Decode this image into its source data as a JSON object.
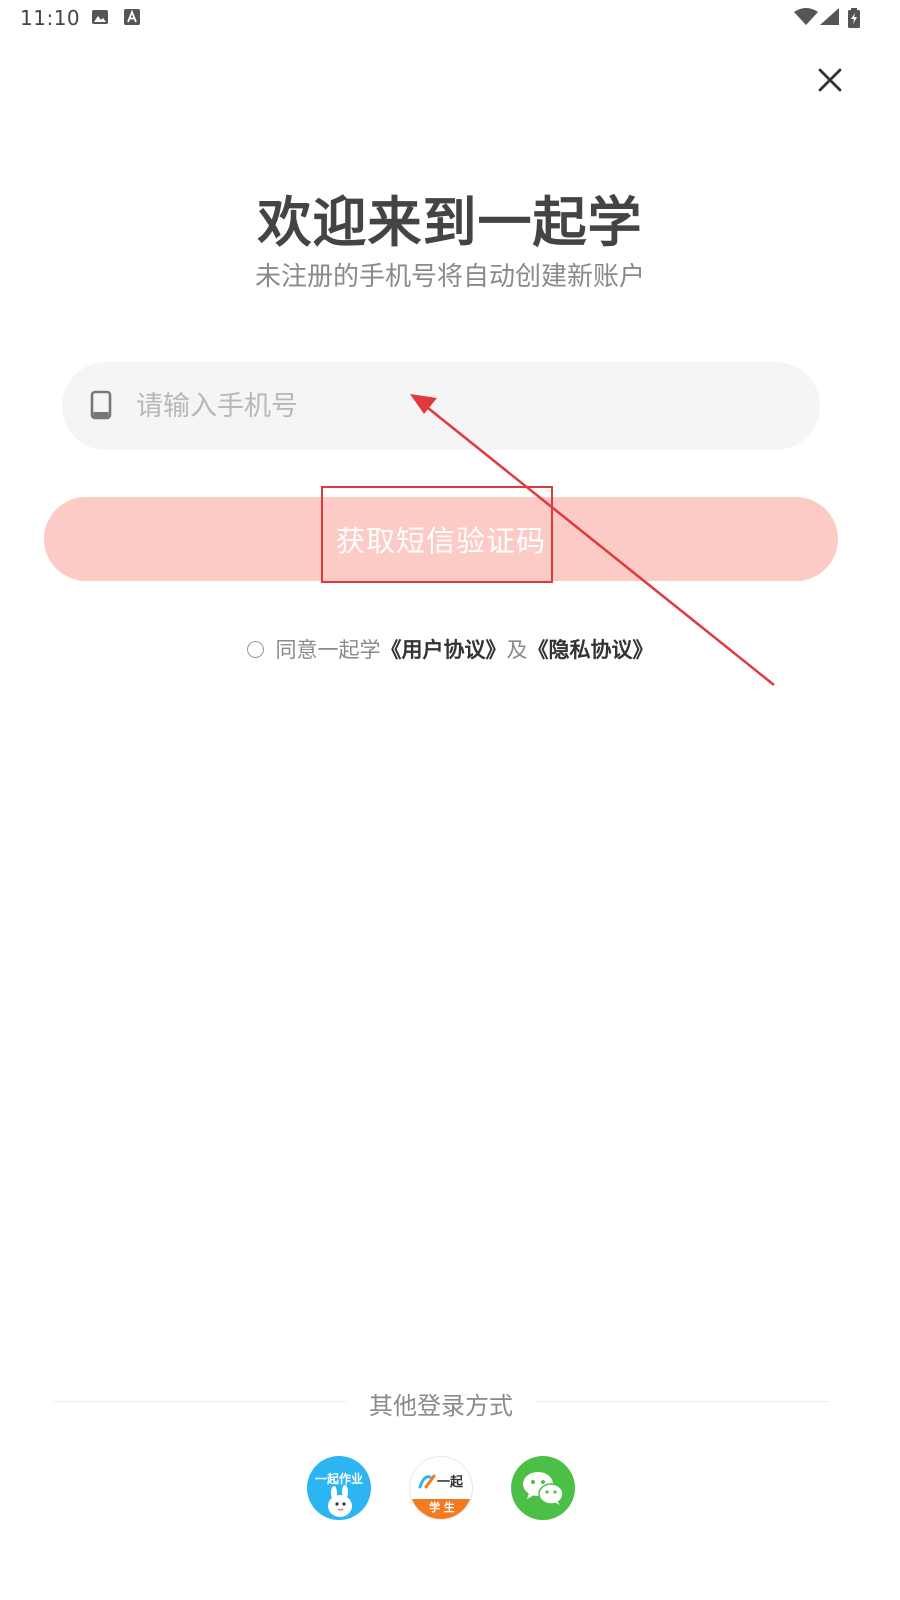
{
  "status_bar": {
    "time": "11:10",
    "icons": [
      "gallery-icon",
      "a-icon",
      "wifi-icon",
      "signal-icon",
      "battery-icon"
    ]
  },
  "header": {
    "title": "欢迎来到一起学",
    "subtitle": "未注册的手机号将自动创建新账户"
  },
  "phone": {
    "placeholder": "请输入手机号",
    "value": "",
    "icon": "phone-icon"
  },
  "sms_button": {
    "label": "获取短信验证码",
    "color": "#fdcbc6"
  },
  "agreement": {
    "checked": false,
    "prefix": "同意一起学",
    "user_agreement": "《用户协议》",
    "and": "及",
    "privacy_agreement": "《隐私协议》"
  },
  "other_login": {
    "label": "其他登录方式",
    "options": [
      {
        "name": "yiqi-homework",
        "text": "一起作业"
      },
      {
        "name": "yiqi-student",
        "top": "一起",
        "bottom": "学 生"
      },
      {
        "name": "wechat"
      }
    ]
  },
  "annotation": {
    "color": "#e0393e"
  }
}
